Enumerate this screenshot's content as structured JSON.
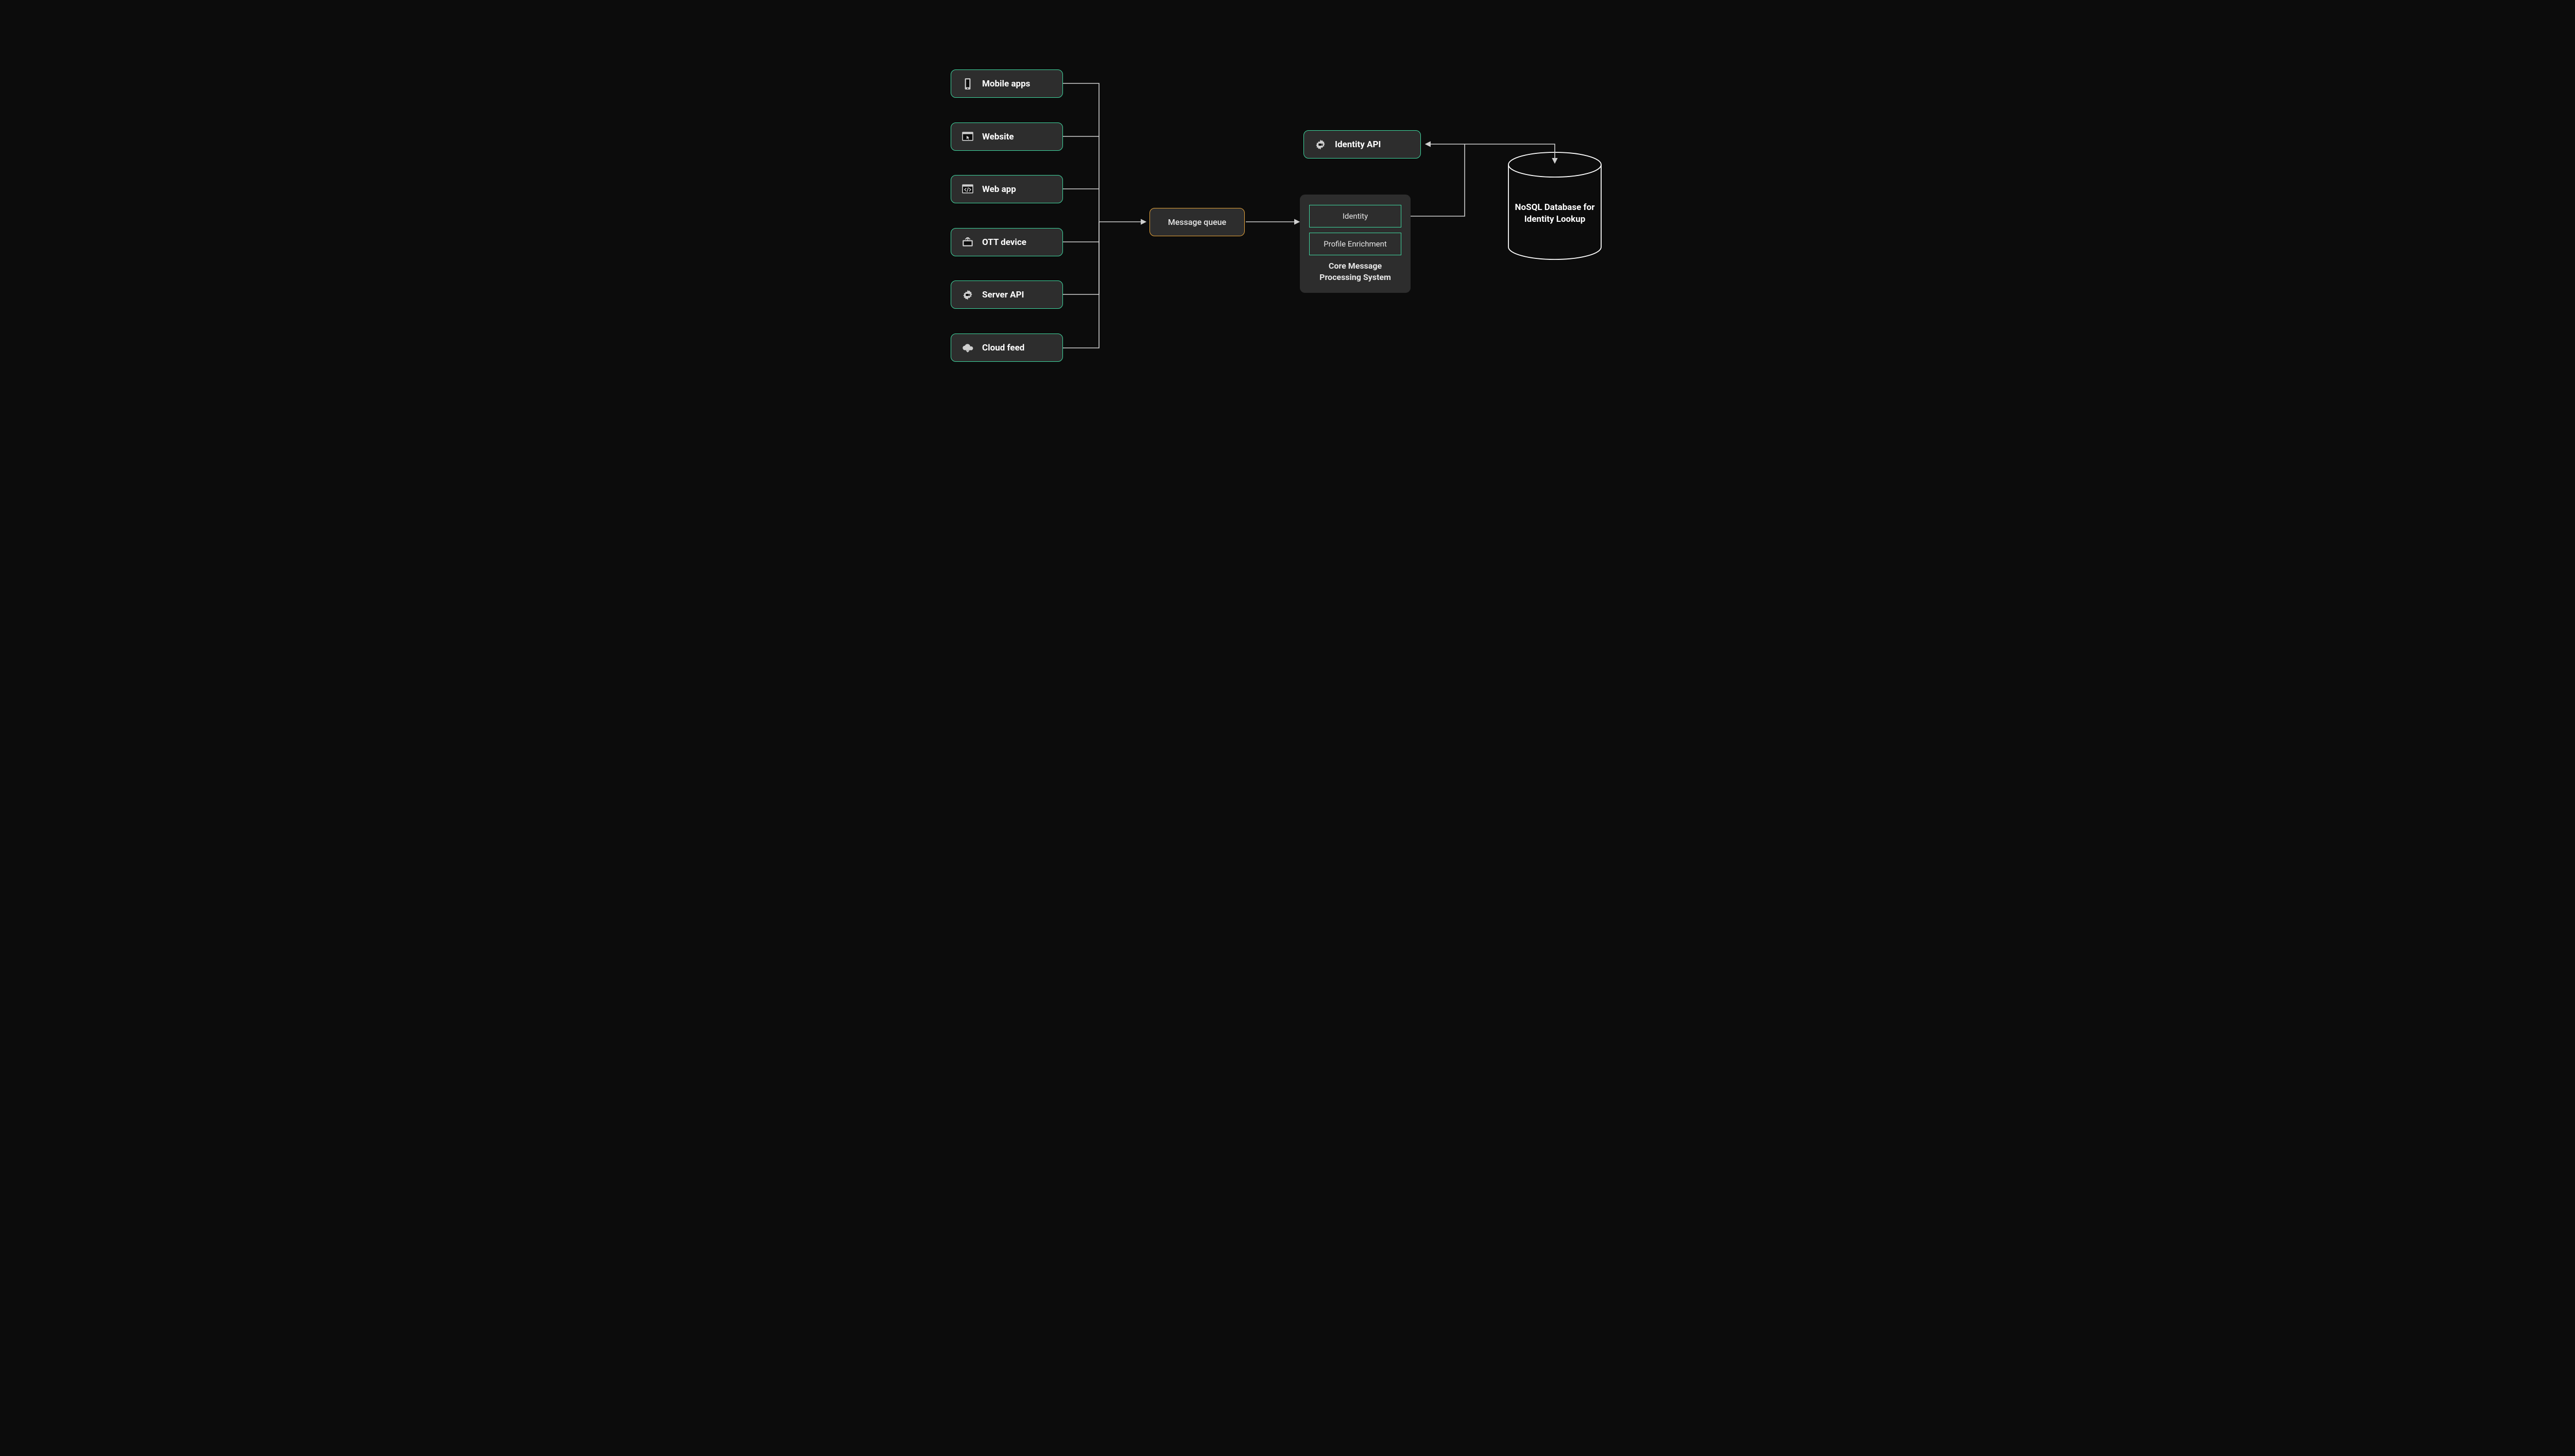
{
  "sources": [
    {
      "label": "Mobile apps",
      "icon": "mobile"
    },
    {
      "label": "Website",
      "icon": "browser-pointer"
    },
    {
      "label": "Web app",
      "icon": "browser-code"
    },
    {
      "label": "OTT device",
      "icon": "ott"
    },
    {
      "label": "Server API",
      "icon": "gear-plug"
    },
    {
      "label": "Cloud feed",
      "icon": "cloud-down"
    }
  ],
  "queue": {
    "label": "Message queue"
  },
  "identity_api": {
    "label": "Identity API",
    "icon": "gear-plug"
  },
  "core": {
    "cells": [
      "Identity",
      "Profile Enrichment"
    ],
    "caption": "Core Message Processing System"
  },
  "db": {
    "label": "NoSQL Database for Identity Lookup"
  },
  "colors": {
    "accent": "#40d9a1",
    "queue": "#e7a43a",
    "panel": "#2d2d2d",
    "bg": "#0c0c0c",
    "wire": "#cfcfcf"
  }
}
